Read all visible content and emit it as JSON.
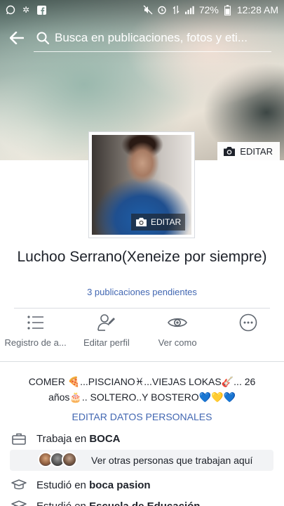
{
  "status_bar": {
    "battery": "72%",
    "time": "12:28 AM"
  },
  "search": {
    "placeholder": "Busca en publicaciones, fotos y eti..."
  },
  "cover": {
    "edit_label": "EDITAR"
  },
  "avatar": {
    "edit_label": "EDITAR"
  },
  "profile": {
    "name": "Luchoo Serrano(Xeneize por siempre)",
    "pending": "3 publicaciones pendientes"
  },
  "actions": [
    {
      "label": "Registro de a...",
      "icon": "list-icon"
    },
    {
      "label": "Editar perfil",
      "icon": "edit-profile-icon"
    },
    {
      "label": "Ver como",
      "icon": "eye-icon"
    },
    {
      "label": "",
      "icon": "more-icon"
    }
  ],
  "bio": {
    "line1": "COMER 🍕...PISCIANO♓...VIEJAS LOKAS🎸... 26",
    "line2": "años🎂.. SOLTERO..Y BOSTERO💙💛💙"
  },
  "edit_details_label": "EDITAR DATOS PERSONALES",
  "work": {
    "prefix": "Trabaja en",
    "place": "BOCA"
  },
  "coworkers": {
    "label": "Ver otras personas que trabajan aquí"
  },
  "education": [
    {
      "prefix": "Estudió en",
      "place": "boca pasion"
    },
    {
      "prefix": "Estudió en",
      "place": "Escuela de Educación"
    }
  ],
  "colors": {
    "link_blue": "#4267b2",
    "text": "#1d2129",
    "muted": "#606770"
  }
}
